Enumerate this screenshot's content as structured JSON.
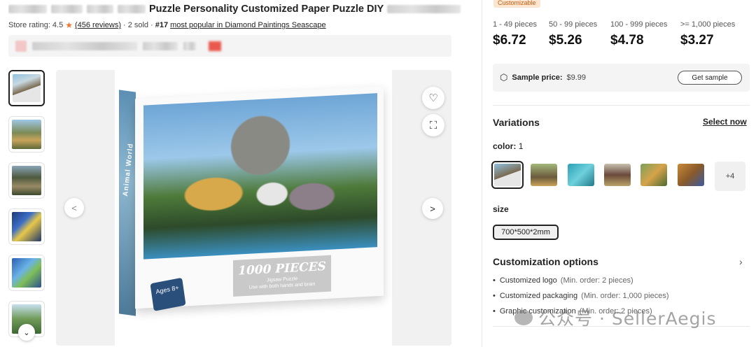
{
  "product": {
    "title": "Puzzle Personality Customized Paper Puzzle DIY",
    "store_rating_label": "Store rating:",
    "store_rating_value": "4.5",
    "reviews": "(456 reviews)",
    "separator": "·",
    "sold": "2 sold",
    "rank_number": "#17",
    "rank_text": "most popular in Diamond Paintings Seascape"
  },
  "gallery": {
    "box_title": "1000 PIECES",
    "box_subtitle": "Jigsaw Puzzle",
    "box_tagline": "Use with both hands and brain",
    "box_ages": "Ages 8+",
    "box_spine": "Animal World",
    "icons": {
      "favorite": "heart-icon",
      "scan": "scan-icon",
      "prev": "chevron-left-icon",
      "next": "chevron-right-icon",
      "more": "chevron-down-icon"
    }
  },
  "pricing": {
    "badge": "Customizable",
    "tiers": [
      {
        "range": "1 - 49 pieces",
        "price": "$6.72"
      },
      {
        "range": "50 - 99 pieces",
        "price": "$5.26"
      },
      {
        "range": "100 - 999 pieces",
        "price": "$4.78"
      },
      {
        "range": ">= 1,000 pieces",
        "price": "$3.27"
      }
    ],
    "sample_label": "Sample price:",
    "sample_value": "$9.99",
    "get_sample": "Get sample"
  },
  "variations": {
    "heading": "Variations",
    "select_now": "Select now",
    "color_label": "color:",
    "color_value": "1",
    "more_colors": "+4",
    "size_label": "size",
    "size_value": "700*500*2mm"
  },
  "customization": {
    "heading": "Customization options",
    "options": [
      {
        "name": "Customized logo",
        "note": "(Min. order: 2 pieces)"
      },
      {
        "name": "Customized packaging",
        "note": "(Min. order: 1,000 pieces)"
      },
      {
        "name": "Graphic customization",
        "note": "(Min. order: 2 pieces)"
      }
    ]
  },
  "watermark": "公众号 · SellerAegis",
  "colors": {
    "accent_star": "#f1752f",
    "badge_bg": "#fde6d0",
    "badge_text": "#c45b12"
  }
}
